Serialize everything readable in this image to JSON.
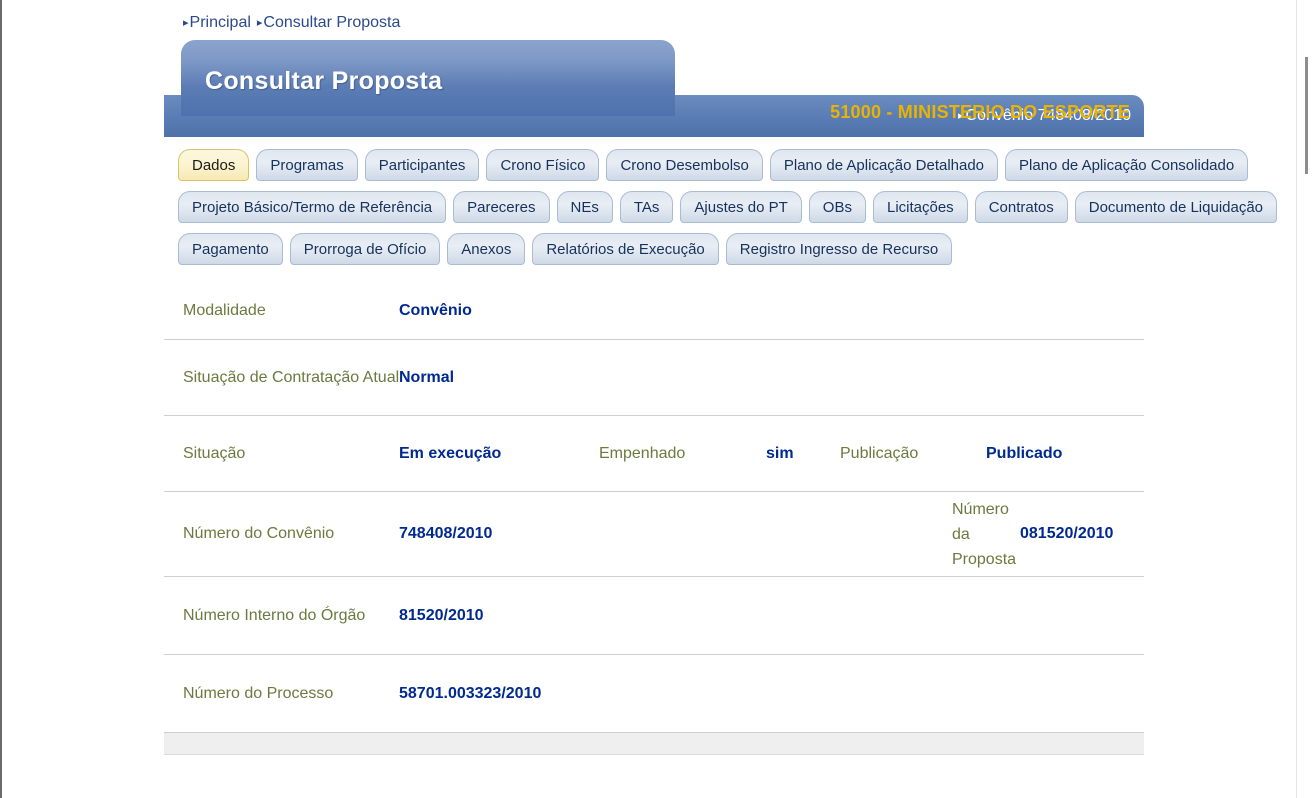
{
  "breadcrumb": {
    "items": [
      {
        "label": "Principal"
      },
      {
        "label": "Consultar Proposta"
      }
    ]
  },
  "header": {
    "title": "Consultar Proposta",
    "organization": "51000 - MINISTERIO DO ESPORTE",
    "context_label": "Convênio 748408/2010",
    "colors": {
      "title_bar": "#5a7cb4",
      "organization_text": "#e8b400",
      "breadcrumb_text": "#2b4a8b"
    }
  },
  "tabs": {
    "active": "Dados",
    "rows": [
      [
        {
          "label": "Dados",
          "active": true
        },
        {
          "label": "Programas",
          "active": false
        },
        {
          "label": "Participantes",
          "active": false
        },
        {
          "label": "Crono Físico",
          "active": false
        },
        {
          "label": "Crono Desembolso",
          "active": false
        },
        {
          "label": "Plano de Aplicação Detalhado",
          "active": false
        },
        {
          "label": "Plano de Aplicação Consolidado",
          "active": false
        }
      ],
      [
        {
          "label": "Projeto Básico/Termo de Referência",
          "active": false
        },
        {
          "label": "Pareceres",
          "active": false
        },
        {
          "label": "NEs",
          "active": false
        },
        {
          "label": "TAs",
          "active": false
        },
        {
          "label": "Ajustes do PT",
          "active": false
        },
        {
          "label": "OBs",
          "active": false
        },
        {
          "label": "Licitações",
          "active": false
        },
        {
          "label": "Contratos",
          "active": false
        },
        {
          "label": "Documento de Liquidação",
          "active": false
        }
      ],
      [
        {
          "label": "Pagamento",
          "active": false
        },
        {
          "label": "Prorroga de Ofício",
          "active": false
        },
        {
          "label": "Anexos",
          "active": false
        },
        {
          "label": "Relatórios de Execução",
          "active": false
        },
        {
          "label": "Registro Ingresso de Recurso",
          "active": false
        }
      ]
    ]
  },
  "details": {
    "modalidade": {
      "label": "Modalidade",
      "value": "Convênio"
    },
    "situacao_contratacao": {
      "label": "Situação de Contratação Atual",
      "value": "Normal"
    },
    "situacao": {
      "label": "Situação",
      "value": "Em execução",
      "empenhado_label": "Empenhado",
      "empenhado_value": "sim",
      "publicacao_label": "Publicação",
      "publicacao_value": "Publicado"
    },
    "numero_convenio": {
      "label": "Número do Convênio",
      "value": "748408/2010",
      "proposta_label": "Número da Proposta",
      "proposta_value": "081520/2010"
    },
    "numero_interno": {
      "label": "Número Interno do Órgão",
      "value": "81520/2010"
    },
    "numero_processo": {
      "label": "Número do Processo",
      "value": "58701.003323/2010"
    }
  },
  "colors": {
    "label_text": "#6b7a3e",
    "value_text": "#002a8f",
    "divider": "#cfcfcf"
  }
}
